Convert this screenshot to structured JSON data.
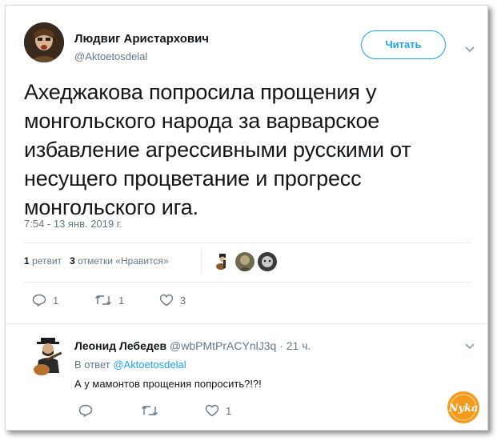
{
  "tweet": {
    "author_name": "Людвиг Аристархович",
    "author_handle": "@Aktoetosdelal",
    "follow_label": "Читать",
    "text": "Ахеджакова попросила прощения у монгольского народа за варварское избавление агрессивными русскими от несущего процветание и прогресс монгольского ига.",
    "timestamp": "7:54 - 13 янв. 2019 г.",
    "retweets_count": "1",
    "retweets_label": "ретвит",
    "likes_count": "3",
    "likes_label": "отметки «Нравится»",
    "actions": {
      "reply_count": "1",
      "retweet_count": "1",
      "like_count": "3"
    }
  },
  "reply": {
    "author_name": "Леонид Лебедев",
    "author_handle": "@wbPMtPrACYnlJ3q",
    "age": "· 21 ч.",
    "in_reply_to_label": "В ответ",
    "in_reply_to_handle": "@Aktoetosdelal",
    "text": "А у мамонтов прощения попросить?!?!",
    "actions": {
      "reply_count": "",
      "retweet_count": "",
      "like_count": "1"
    }
  },
  "watermark": {
    "text": "Nyka"
  },
  "icons": [
    "chevron-down-icon",
    "reply-icon",
    "retweet-icon",
    "like-icon"
  ],
  "colors": {
    "accent": "#1da1f2",
    "secondary_text": "#657786",
    "primary_text": "#14171a",
    "watermark": "#f39a1e"
  }
}
